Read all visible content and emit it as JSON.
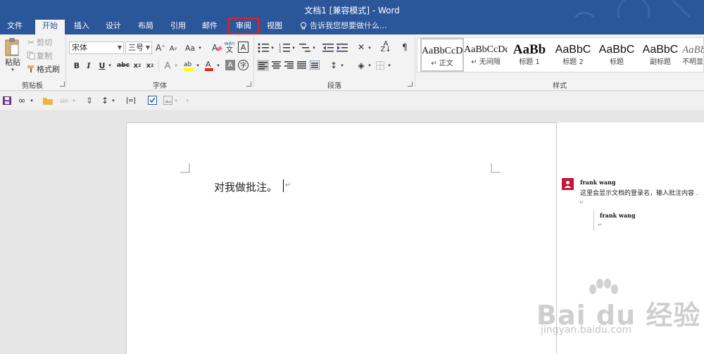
{
  "window": {
    "title": "文档1 [兼容模式] - Word"
  },
  "tabs": [
    "文件",
    "开始",
    "插入",
    "设计",
    "布局",
    "引用",
    "邮件",
    "审阅",
    "视图"
  ],
  "active_tab": "开始",
  "highlighted_tab": "审阅",
  "tell_me": "告诉我您想要做什么...",
  "clipboard": {
    "paste": "粘贴",
    "cut": "剪切",
    "copy": "复制",
    "format_painter": "格式刷",
    "group": "剪贴板"
  },
  "font": {
    "name": "宋体",
    "size": "三号",
    "group": "字体",
    "aa_label": "Aa",
    "wen_label": "wén",
    "wen_char": "文"
  },
  "paragraph": {
    "group": "段落"
  },
  "styles": {
    "group": "样式",
    "items": [
      {
        "preview": "AaBbCcDd",
        "name": "↵ 正文"
      },
      {
        "preview": "AaBbCcDd",
        "name": "↵ 无间隔"
      },
      {
        "preview": "AaBb",
        "name": "标题 1"
      },
      {
        "preview": "AaBbC",
        "name": "标题 2"
      },
      {
        "preview": "AaBbC",
        "name": "标题"
      },
      {
        "preview": "AaBbC",
        "name": "副标题"
      },
      {
        "preview": "AaBb",
        "name": "不明显"
      }
    ]
  },
  "document": {
    "text": "对我做批注。"
  },
  "comments": {
    "author": "frank wang",
    "text": "这里会显示文档的登录名，输入批注内容 .",
    "reply_author": "frank wang"
  },
  "watermark": {
    "brand": "Bai du 经验",
    "url": "jingyan.baidu.com"
  },
  "colors": {
    "accent": "#2b579a",
    "highlight_border": "#e51f1f",
    "avatar": "#c4153a"
  }
}
